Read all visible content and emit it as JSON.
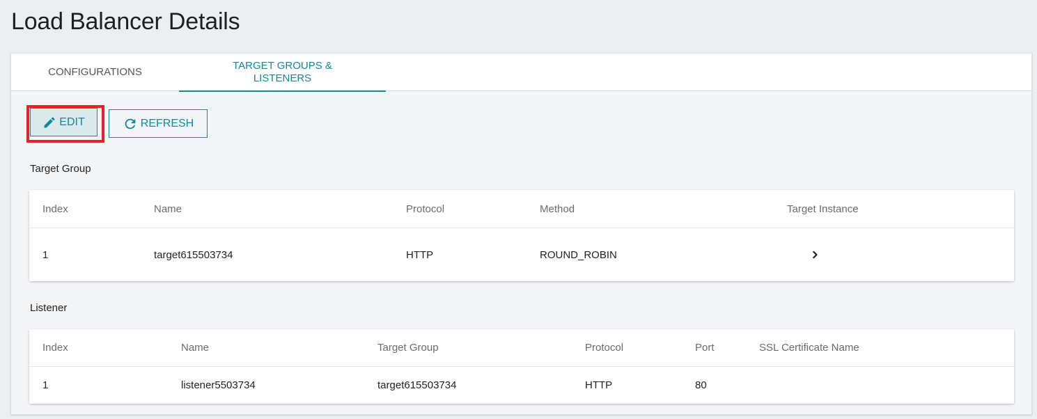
{
  "page": {
    "title": "Load Balancer Details"
  },
  "tabs": [
    {
      "label": "CONFIGURATIONS",
      "active": false
    },
    {
      "label": "TARGET GROUPS & LISTENERS",
      "active": true
    }
  ],
  "toolbar": {
    "edit_label": "EDIT",
    "refresh_label": "REFRESH",
    "edit_icon": "pencil-icon",
    "refresh_icon": "refresh-icon",
    "accent_color": "#12889a",
    "highlight_color": "#e8202a"
  },
  "target_group": {
    "section_label": "Target Group",
    "headers": [
      "Index",
      "Name",
      "Protocol",
      "Method",
      "Target Instance"
    ],
    "rows": [
      {
        "index": "1",
        "name": "target615503734",
        "protocol": "HTTP",
        "method": "ROUND_ROBIN",
        "target_instance_icon": "chevron-right-icon"
      }
    ]
  },
  "listener": {
    "section_label": "Listener",
    "headers": [
      "Index",
      "Name",
      "Target Group",
      "Protocol",
      "Port",
      "SSL Certificate Name"
    ],
    "rows": [
      {
        "index": "1",
        "name": "listener5503734",
        "target_group": "target615503734",
        "protocol": "HTTP",
        "port": "80",
        "ssl_certificate_name": ""
      }
    ]
  }
}
